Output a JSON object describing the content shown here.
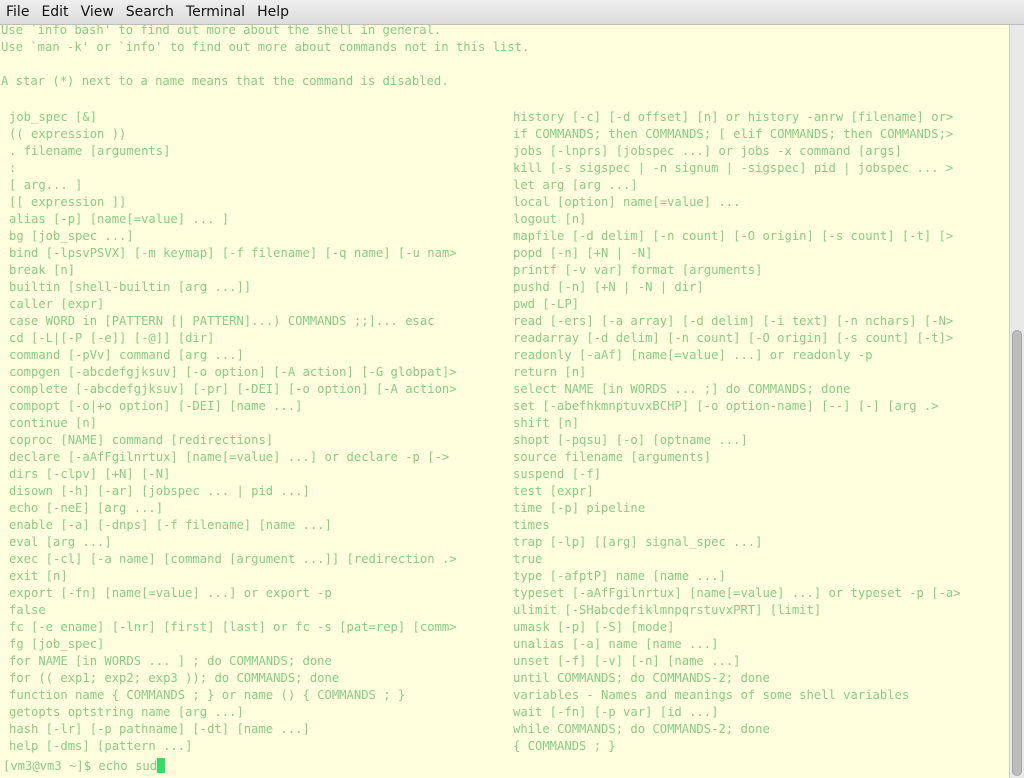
{
  "menubar": {
    "items": [
      "File",
      "Edit",
      "View",
      "Search",
      "Terminal",
      "Help"
    ]
  },
  "terminal": {
    "header_lines": [
      "Use `info bash' to find out more about the shell in general.",
      "Use `man -k' or `info' to find out more about commands not in this list.",
      "",
      "A star (*) next to a name means that the command is disabled."
    ],
    "left_column": [
      "job_spec [&]",
      "(( expression ))",
      ". filename [arguments]",
      ":",
      "[ arg... ]",
      "[[ expression ]]",
      "alias [-p] [name[=value] ... ]",
      "bg [job_spec ...]",
      "bind [-lpsvPSVX] [-m keymap] [-f filename] [-q name] [-u nam>",
      "break [n]",
      "builtin [shell-builtin [arg ...]]",
      "caller [expr]",
      "case WORD in [PATTERN [| PATTERN]...) COMMANDS ;;]... esac",
      "cd [-L|[-P [-e]] [-@]] [dir]",
      "command [-pVv] command [arg ...]",
      "compgen [-abcdefgjksuv] [-o option] [-A action] [-G globpat]>",
      "complete [-abcdefgjksuv] [-pr] [-DEI] [-o option] [-A action>",
      "compopt [-o|+o option] [-DEI] [name ...]",
      "continue [n]",
      "coproc [NAME] command [redirections]",
      "declare [-aAfFgilnrtux] [name[=value] ...] or declare -p [->",
      "dirs [-clpv] [+N] [-N]",
      "disown [-h] [-ar] [jobspec ... | pid ...]",
      "echo [-neE] [arg ...]",
      "enable [-a] [-dnps] [-f filename] [name ...]",
      "eval [arg ...]",
      "exec [-cl] [-a name] [command [argument ...]] [redirection .>",
      "exit [n]",
      "export [-fn] [name[=value] ...] or export -p",
      "false",
      "fc [-e ename] [-lnr] [first] [last] or fc -s [pat=rep] [comm>",
      "fg [job_spec]",
      "for NAME [in WORDS ... ] ; do COMMANDS; done",
      "for (( exp1; exp2; exp3 )); do COMMANDS; done",
      "function name { COMMANDS ; } or name () { COMMANDS ; }",
      "getopts optstring name [arg ...]",
      "hash [-lr] [-p pathname] [-dt] [name ...]",
      "help [-dms] [pattern ...]"
    ],
    "right_column": [
      "history [-c] [-d offset] [n] or history -anrw [filename] or>",
      "if COMMANDS; then COMMANDS; [ elif COMMANDS; then COMMANDS;>",
      "jobs [-lnprs] [jobspec ...] or jobs -x command [args]",
      "kill [-s sigspec | -n signum | -sigspec] pid | jobspec ... >",
      "let arg [arg ...]",
      "local [option] name[=value] ...",
      "logout [n]",
      "mapfile [-d delim] [-n count] [-O origin] [-s count] [-t] [>",
      "popd [-n] [+N | -N]",
      "printf [-v var] format [arguments]",
      "pushd [-n] [+N | -N | dir]",
      "pwd [-LP]",
      "read [-ers] [-a array] [-d delim] [-i text] [-n nchars] [-N>",
      "readarray [-d delim] [-n count] [-O origin] [-s count] [-t]>",
      "readonly [-aAf] [name[=value] ...] or readonly -p",
      "return [n]",
      "select NAME [in WORDS ... ;] do COMMANDS; done",
      "set [-abefhkmnptuvxBCHP] [-o option-name] [--] [-] [arg .>",
      "shift [n]",
      "shopt [-pqsu] [-o] [optname ...]",
      "source filename [arguments]",
      "suspend [-f]",
      "test [expr]",
      "time [-p] pipeline",
      "times",
      "trap [-lp] [[arg] signal_spec ...]",
      "true",
      "type [-afptP] name [name ...]",
      "typeset [-aAfFgilnrtux] [name[=value] ...] or typeset -p [-a>",
      "ulimit [-SHabcdefiklmnpqrstuvxPRT] [limit]",
      "umask [-p] [-S] [mode]",
      "unalias [-a] name [name ...]",
      "unset [-f] [-v] [-n] [name ...]",
      "until COMMANDS; do COMMANDS-2; done",
      "variables - Names and meanings of some shell variables",
      "wait [-fn] [-p var] [id ...]",
      "while COMMANDS; do COMMANDS-2; done",
      "{ COMMANDS ; }"
    ],
    "prompt": "[vm3@vm3 ~]$ echo sud"
  },
  "colors": {
    "background": "#ffffdd",
    "text": "#88cc88",
    "cursor": "#33dd66"
  }
}
